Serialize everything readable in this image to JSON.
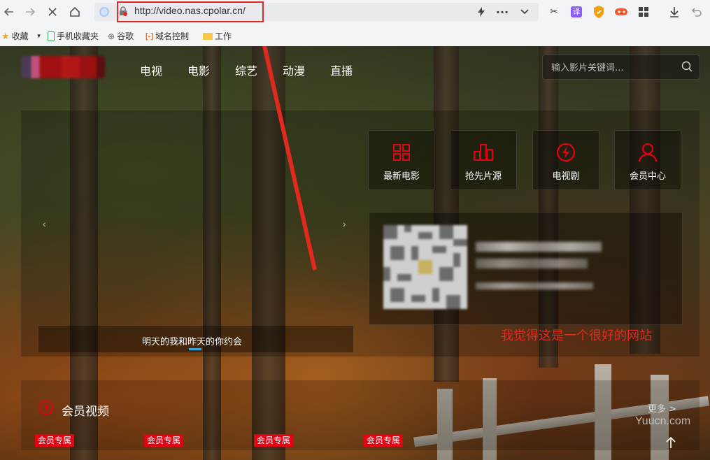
{
  "browser": {
    "url": "http://video.nas.cpolar.cn/",
    "bookmarks": [
      "收藏",
      "手机收藏夹",
      "谷歌",
      "域名控制",
      "工作"
    ]
  },
  "site": {
    "nav": [
      "电视",
      "电影",
      "综艺",
      "动漫",
      "直播"
    ],
    "search_placeholder": "输入影片关键词...",
    "slide_title": "明天的我和昨天的你约会",
    "quick_links": [
      "最新电影",
      "抢先片源",
      "电视剧",
      "会员中心"
    ],
    "annotation": "我觉得这是一个很好的网站",
    "section_title": "会员视频",
    "more_label": "更多 >",
    "vip_badges": [
      "会员专属",
      "会员专属",
      "会员专属",
      "会员专属"
    ],
    "watermark": "Yuucn.com"
  },
  "colors": {
    "accent": "#e60012",
    "annotation": "#e02a20",
    "slider_dot": "#3aa0e0"
  },
  "icons": [
    "back-icon",
    "forward-icon",
    "stop-icon",
    "home-icon",
    "lightning-icon",
    "more-icon",
    "chevron-down-icon",
    "scissors-icon",
    "translate-icon",
    "shield-icon",
    "game-icon",
    "apps-icon",
    "download-icon",
    "undo-icon",
    "search-icon",
    "grid-icon",
    "bars-icon",
    "tv-icon",
    "user-icon",
    "arrow-up-icon"
  ]
}
